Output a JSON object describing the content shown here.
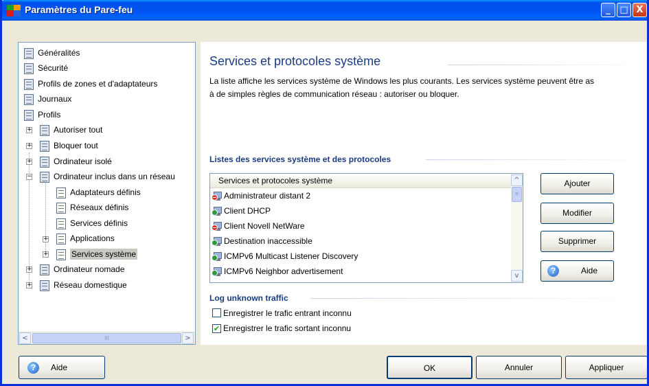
{
  "window": {
    "title": "Paramètres du Pare-feu",
    "buttons": {
      "minimize": "_",
      "maximize": "□",
      "close": "X"
    }
  },
  "tree": {
    "items": [
      {
        "label": "Généralités"
      },
      {
        "label": "Sécurité"
      },
      {
        "label": "Profils de zones et d'adaptateurs"
      },
      {
        "label": "Journaux"
      },
      {
        "label": "Profils"
      },
      {
        "label": "Autoriser tout"
      },
      {
        "label": "Bloquer tout"
      },
      {
        "label": "Ordinateur isolé"
      },
      {
        "label": "Ordinateur inclus dans un réseau"
      },
      {
        "label": "Adaptateurs définis"
      },
      {
        "label": "Réseaux définis"
      },
      {
        "label": "Services définis"
      },
      {
        "label": "Applications"
      },
      {
        "label": "Services système"
      },
      {
        "label": "Ordinateur nomade"
      },
      {
        "label": "Réseau domestique"
      }
    ],
    "expanders": {
      "collapsed": "+",
      "expanded": "−"
    },
    "selected": "Services système"
  },
  "scrollbar": {
    "left": "<",
    "right": ">",
    "thumb": "III",
    "up": "^",
    "down": "v",
    "vthumb": "≡"
  },
  "main": {
    "title": "Services et protocoles système",
    "description_line1": "La liste affiche les services système de Windows les plus courants. Les services système peuvent être as",
    "description_line2": "à de simples règles de communication réseau : autoriser ou bloquer.",
    "list_section_title": "Listes des services système et des protocoles",
    "list_header": "Services et protocoles système",
    "list_rows": [
      {
        "label": "Administrateur distant 2",
        "status": "block"
      },
      {
        "label": "Client DHCP",
        "status": "allow"
      },
      {
        "label": "Client Novell NetWare",
        "status": "block"
      },
      {
        "label": "Destination inaccessible",
        "status": "allow"
      },
      {
        "label": "ICMPv6 Multicast Listener Discovery",
        "status": "allow"
      },
      {
        "label": "ICMPv6 Neighbor advertisement",
        "status": "allow"
      }
    ],
    "buttons": {
      "add": "Ajouter",
      "modify": "Modifier",
      "delete": "Supprimer",
      "help": "Aide"
    },
    "log_section_title": "Log unknown traffic",
    "checkboxes": [
      {
        "label": "Enregistrer le trafic entrant inconnu",
        "checked": false
      },
      {
        "label": "Enregistrer le trafic sortant inconnu",
        "checked": true
      }
    ]
  },
  "footer": {
    "help": "Aide",
    "ok": "OK",
    "cancel": "Annuler",
    "apply": "Appliquer"
  },
  "colors": {
    "titlebar": "#0053ee",
    "heading": "#1b3b82",
    "block": "#d9322b",
    "allow": "#2f9a39"
  }
}
